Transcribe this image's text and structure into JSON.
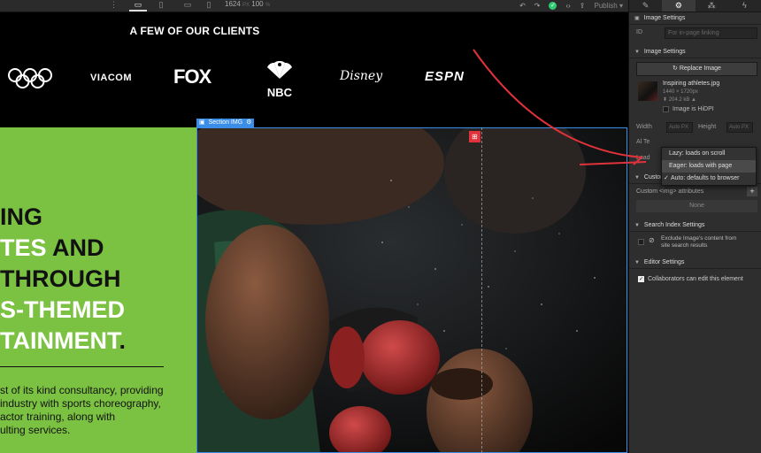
{
  "toolbar": {
    "more": "⋮",
    "width_value": "1624",
    "width_unit": "PX",
    "zoom_value": "100",
    "zoom_unit": "%",
    "publish_label": "Publish",
    "publish_caret": "▾"
  },
  "canvas": {
    "clients_title": "A FEW OF OUR CLIENTS",
    "logos": {
      "viacom": "VIACOM",
      "fox": "FOX",
      "nbc": "NBC",
      "disney": "Disney",
      "espn": "ESPN"
    },
    "headline": {
      "line1": "ING",
      "line2_white": "TES",
      "line2_black": " AND",
      "line3": "THROUGH",
      "line4": "S-THEMED",
      "line5_white": "TAINMENT",
      "line5_black": "."
    },
    "body": {
      "line1": "st of its kind consultancy, providing",
      "line2": "industry with sports choreography,",
      "line3": "actor training, along with",
      "line4": "ulting services."
    },
    "selection_label": "Section IMG"
  },
  "panel": {
    "tabs": [
      "brush-icon",
      "gear-icon",
      "drops-icon",
      "bolt-icon"
    ],
    "element_title": "Image Settings",
    "id_label": "ID",
    "id_placeholder": "For in-page linking",
    "image_settings_header": "Image Settings",
    "replace_button": "Replace Image",
    "image_name": "Inspiring athletes.jpg",
    "image_dims": "1440 × 1720px",
    "image_size": "204.2 kB",
    "hidpi_label": "Image is HiDPI",
    "width_label": "Width",
    "width_value": "Auto",
    "width_unit": "PX",
    "height_label": "Height",
    "height_value": "Auto",
    "height_unit": "PX",
    "alt_label": "Al Te",
    "load_label": "Load",
    "load_options": [
      "Lazy: loads on scroll",
      "Eager: loads with page",
      "Auto: defaults to browser"
    ],
    "custom_attributes_header": "Custom Attributes",
    "custom_img_attributes": "Custom <img> attributes",
    "none_label": "None",
    "search_index_header": "Search Index Settings",
    "exclude_line1": "Exclude Image's content from",
    "exclude_line2": "site search results",
    "editor_settings_header": "Editor Settings",
    "collaborators_label": "Collaborators can edit this element"
  },
  "colors": {
    "accent_green": "#7cc242",
    "selection_blue": "#3b8ee8",
    "annotation_red": "#e0323a"
  }
}
